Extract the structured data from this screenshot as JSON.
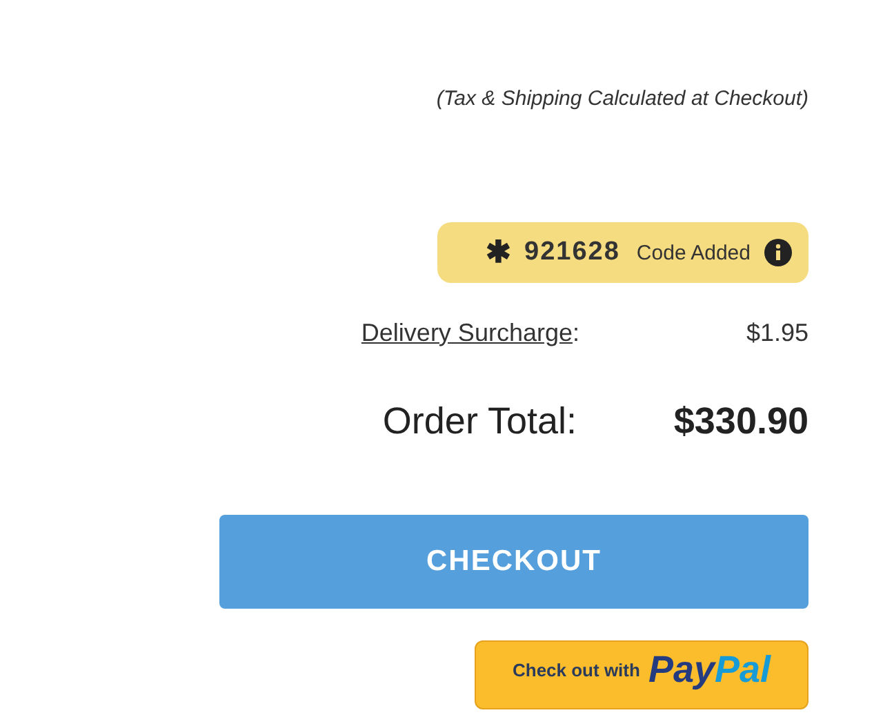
{
  "tax_note": "(Tax & Shipping Calculated at Checkout)",
  "promo": {
    "mark": "✱",
    "code": "921628",
    "status": "Code Added"
  },
  "surcharge": {
    "label": "Delivery Surcharge",
    "colon": ":",
    "value": "$1.95"
  },
  "total": {
    "label": "Order Total:",
    "value": "$330.90"
  },
  "checkout_button": "CHECKOUT",
  "paypal_button": {
    "prefix": "Check out with",
    "logo_parts": [
      "Pay",
      "Pal"
    ]
  }
}
